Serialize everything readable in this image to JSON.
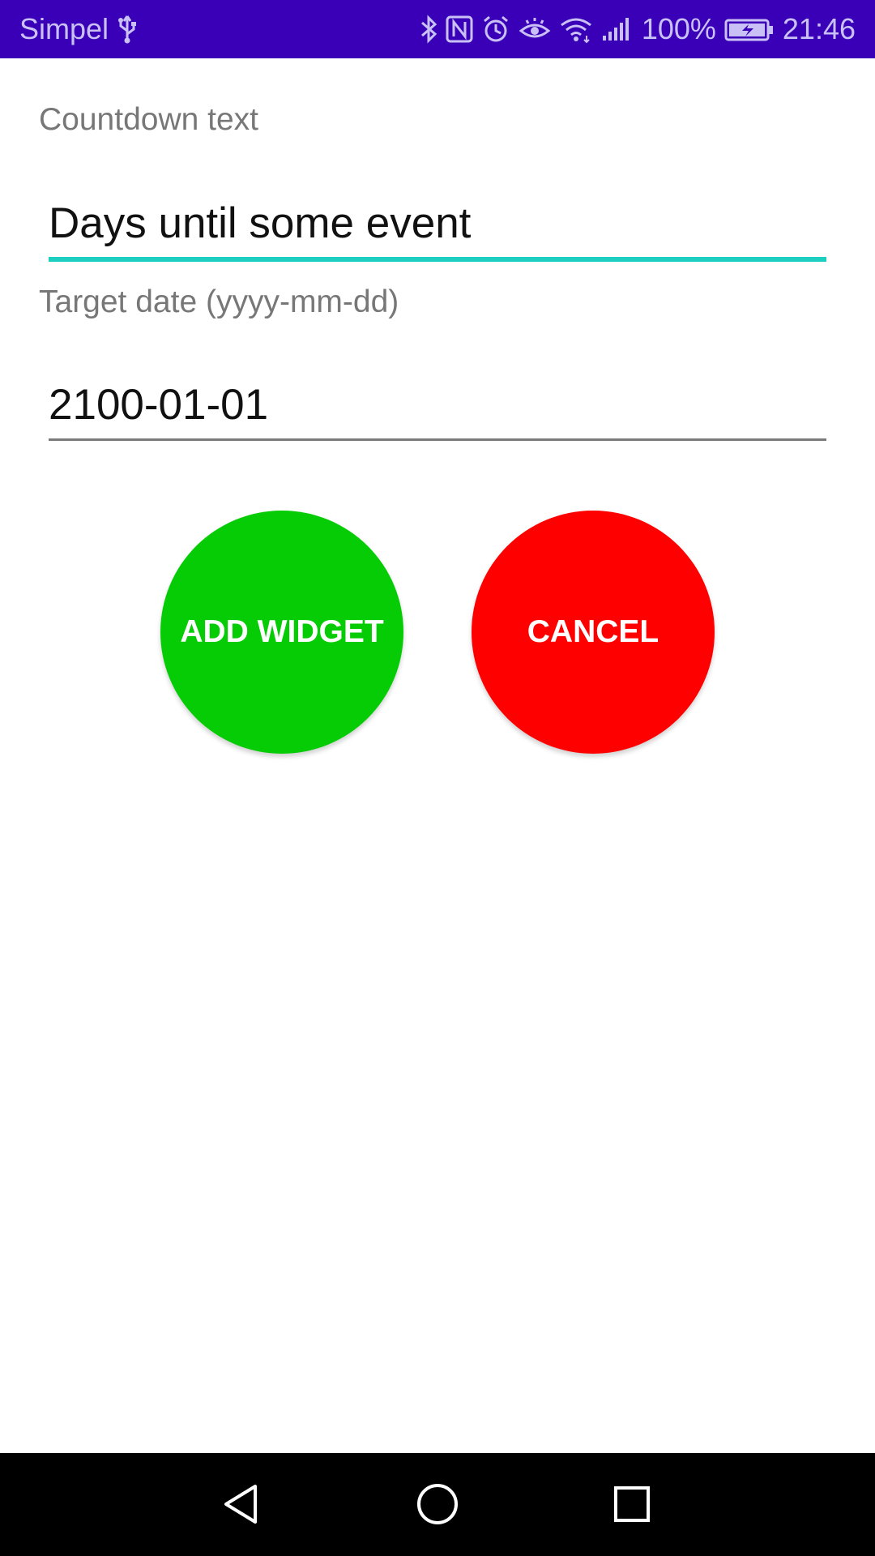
{
  "status_bar": {
    "carrier": "Simpel",
    "battery_percent": "100%",
    "time": "21:46",
    "background_color": "#3a00b8",
    "icons": [
      "usb-icon",
      "bluetooth-icon",
      "nfc-icon",
      "alarm-icon",
      "eye-comfort-icon",
      "wifi-icon",
      "signal-icon",
      "battery-icon"
    ]
  },
  "form": {
    "countdown_label": "Countdown text",
    "countdown_value": "Days until some event",
    "date_label": "Target date (yyyy-mm-dd)",
    "date_value": "2100-01-01",
    "active_underline_color": "#1ccfc0"
  },
  "buttons": {
    "add_label": "ADD WIDGET",
    "add_color": "#05cc05",
    "cancel_label": "CANCEL",
    "cancel_color": "#ff0000"
  },
  "nav_bar": {
    "icons": [
      "back-icon",
      "home-icon",
      "recents-icon"
    ]
  }
}
